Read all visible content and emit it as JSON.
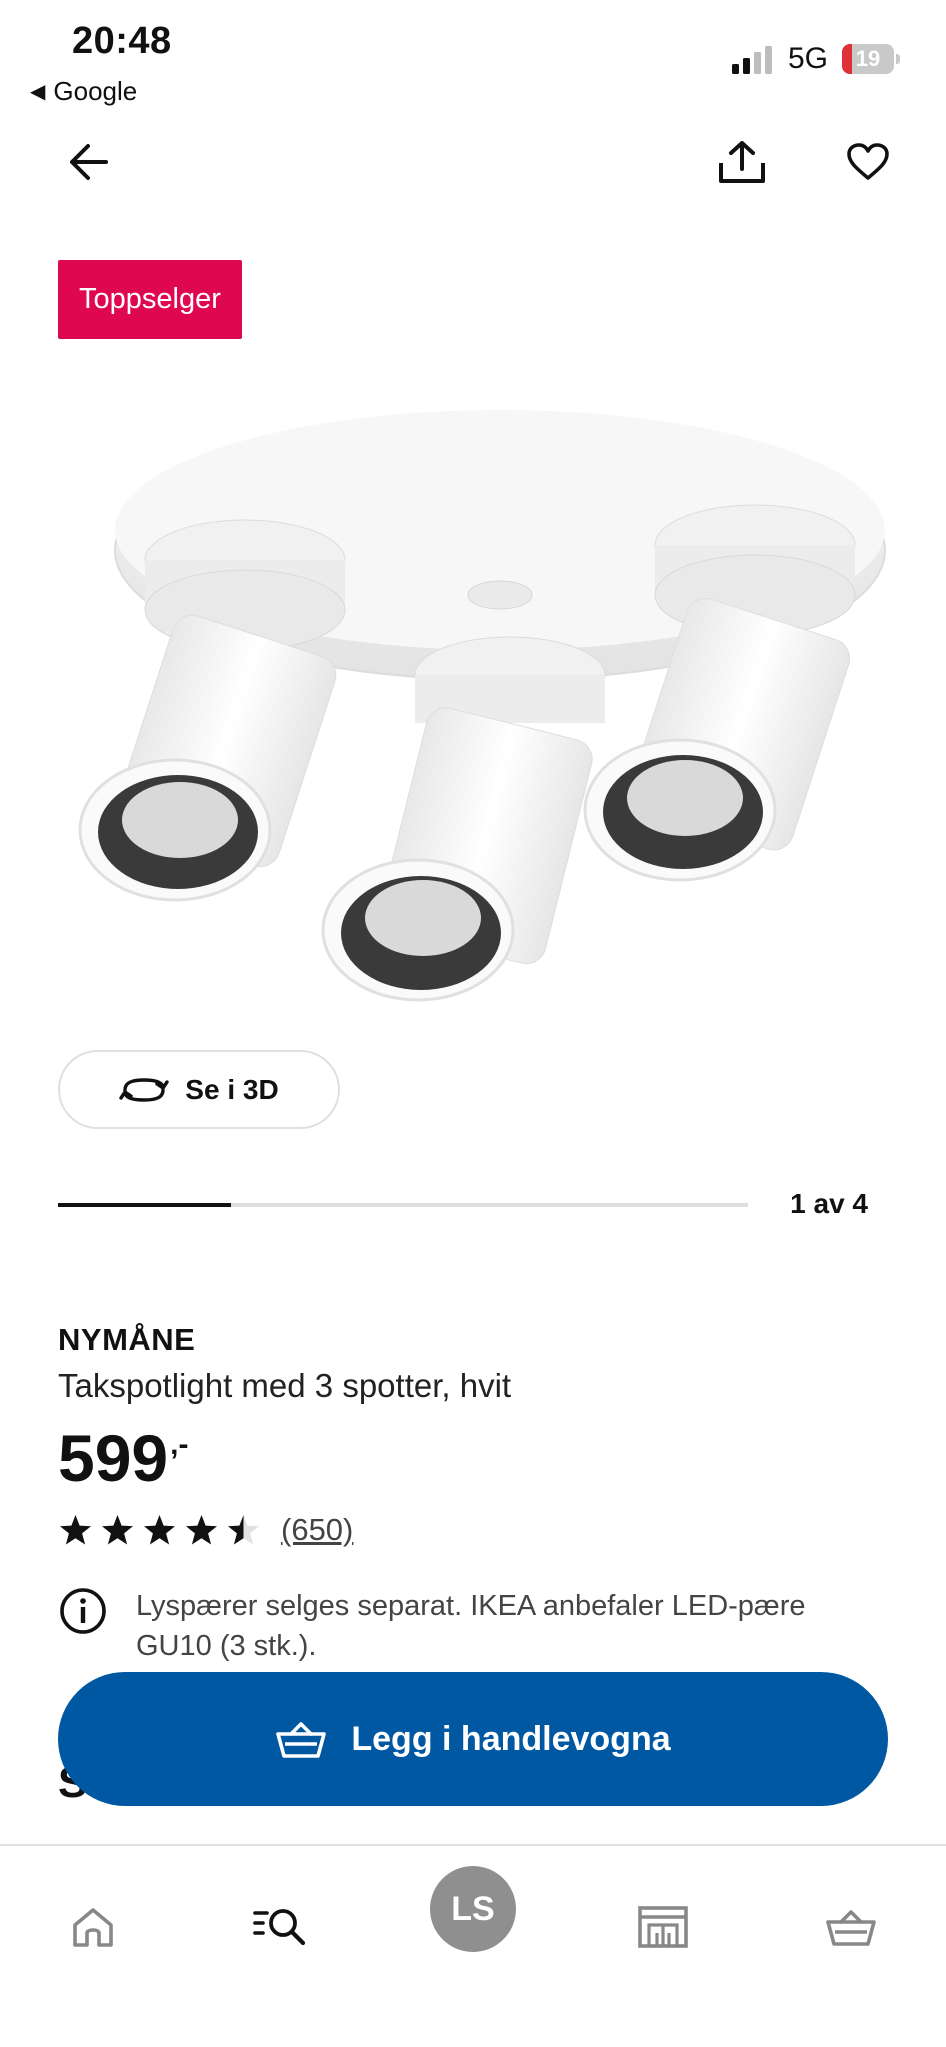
{
  "status_bar": {
    "time": "20:48",
    "back_app": "Google",
    "network": "5G",
    "battery_level": "19",
    "battery_color": "#e0313a"
  },
  "top_nav": {
    "back_icon": "arrow-left-icon",
    "share_icon": "share-icon",
    "favorite_icon": "heart-icon"
  },
  "badge": {
    "label": "Toppselger",
    "color": "#e00751"
  },
  "gallery": {
    "view_3d_label": "Se i 3D",
    "position_label": "1 av 4",
    "current": 1,
    "total": 4
  },
  "product": {
    "name": "NYMÅNE",
    "description": "Takspotlight med 3 spotter, hvit",
    "price": "599",
    "price_suffix": ",-",
    "rating": 4.5,
    "rating_count": "(650)",
    "info_text": "Lyspærer selges separat. IKEA anbefaler LED-pære GU10 (3 stk.)."
  },
  "peek_heading": "St",
  "cta": {
    "label": "Legg i handlevogna",
    "color": "#0058a3"
  },
  "tab_bar": {
    "home_icon": "home-icon",
    "search_icon": "search-list-icon",
    "avatar_initials": "LS",
    "store_icon": "store-icon",
    "cart_icon": "basket-icon"
  }
}
